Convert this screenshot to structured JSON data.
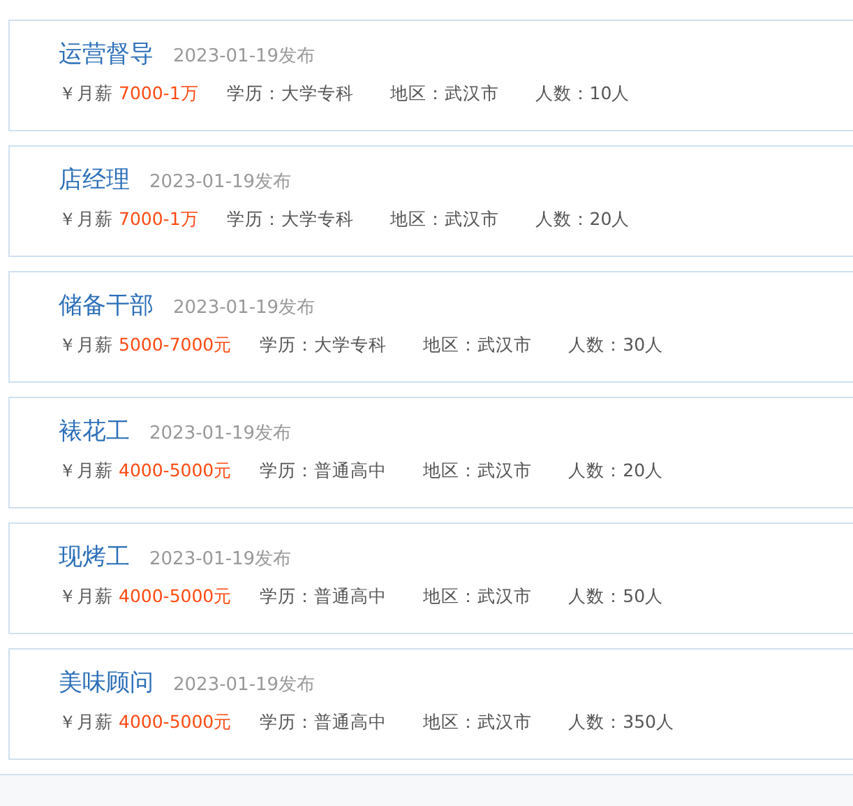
{
  "jobs": [
    {
      "title": "运营督导",
      "date": "2023-01-19发布",
      "salary_label": "￥月薪",
      "salary": "7000-1万",
      "education": "学历：大学专科",
      "region": "地区：武汉市",
      "headcount": "人数：10人"
    },
    {
      "title": "店经理",
      "date": "2023-01-19发布",
      "salary_label": "￥月薪",
      "salary": "7000-1万",
      "education": "学历：大学专科",
      "region": "地区：武汉市",
      "headcount": "人数：20人"
    },
    {
      "title": "储备干部",
      "date": "2023-01-19发布",
      "salary_label": "￥月薪",
      "salary": "5000-7000元",
      "education": "学历：大学专科",
      "region": "地区：武汉市",
      "headcount": "人数：30人"
    },
    {
      "title": "裱花工",
      "date": "2023-01-19发布",
      "salary_label": "￥月薪",
      "salary": "4000-5000元",
      "education": "学历：普通高中",
      "region": "地区：武汉市",
      "headcount": "人数：20人"
    },
    {
      "title": "现烤工",
      "date": "2023-01-19发布",
      "salary_label": "￥月薪",
      "salary": "4000-5000元",
      "education": "学历：普通高中",
      "region": "地区：武汉市",
      "headcount": "人数：50人"
    },
    {
      "title": "美味顾问",
      "date": "2023-01-19发布",
      "salary_label": "￥月薪",
      "salary": "4000-5000元",
      "education": "学历：普通高中",
      "region": "地区：武汉市",
      "headcount": "人数：350人"
    }
  ]
}
